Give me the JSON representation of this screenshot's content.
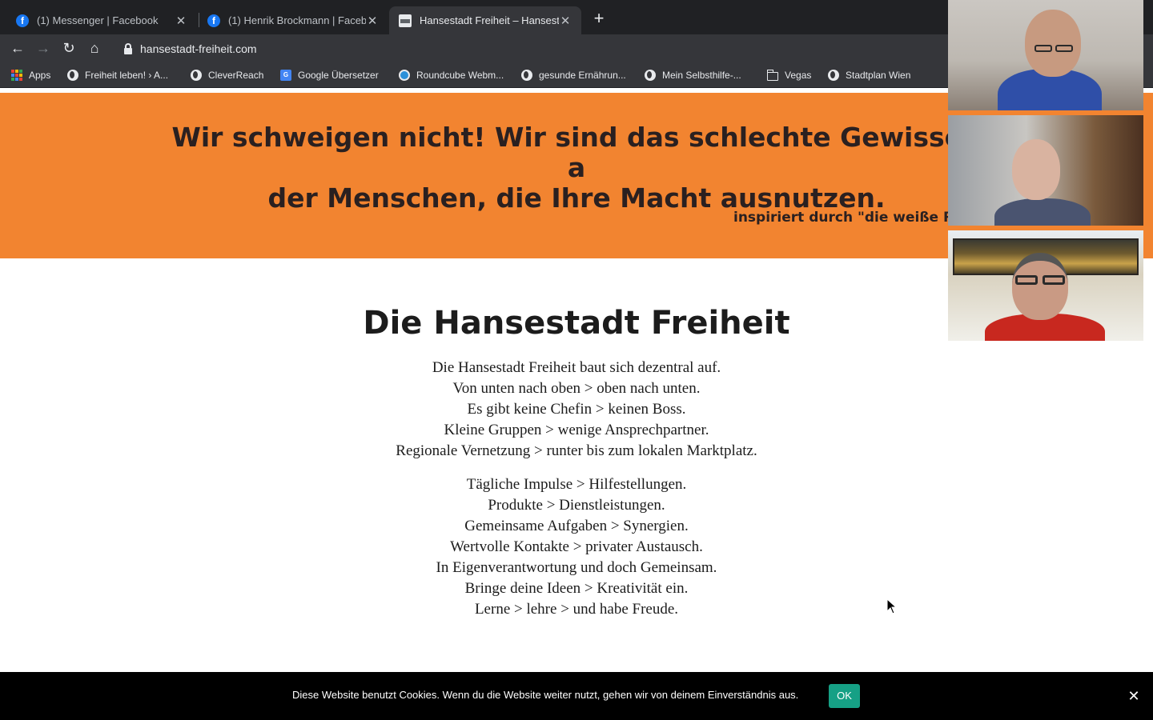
{
  "browser": {
    "tabs": [
      {
        "title": "(1) Messenger | Facebook",
        "icon": "facebook-icon",
        "close": "✕"
      },
      {
        "title": "(1) Henrik Brockmann | Facebook",
        "icon": "facebook-icon",
        "close": "✕"
      },
      {
        "title": "Hansestadt Freiheit – Hansestadt Freiheit",
        "icon": "page-icon",
        "close": "✕"
      }
    ],
    "new_tab": "+",
    "url": "hansestadt-freiheit.com",
    "bookmarks": [
      {
        "label": "Apps",
        "icon": "apps-grid-icon"
      },
      {
        "label": "Freiheit leben! › A...",
        "icon": "globe-icon"
      },
      {
        "label": "CleverReach",
        "icon": "globe-icon"
      },
      {
        "label": "Google Übersetzer",
        "icon": "google-translate-icon"
      },
      {
        "label": "Roundcube Webm...",
        "icon": "roundcube-icon"
      },
      {
        "label": "gesunde Ernährun...",
        "icon": "globe-icon"
      },
      {
        "label": "Mein Selbsthilfe-...",
        "icon": "globe-icon"
      },
      {
        "label": "Vegas",
        "icon": "folder-icon"
      },
      {
        "label": "Stadtplan Wien",
        "icon": "globe-icon"
      }
    ]
  },
  "hero": {
    "title_line1": "Wir schweigen nicht! Wir sind das schlechte Gewissen a",
    "title_line2": "der Menschen, die Ihre Macht ausnutzen.",
    "subtitle": "inspiriert durch \"die weiße Ro",
    "background": "#f28430"
  },
  "section": {
    "title": "Die Hansestadt Freiheit",
    "paragraph1": [
      "Die Hansestadt Freiheit baut sich dezentral auf.",
      "Von unten nach oben > oben nach unten.",
      "Es gibt keine Chefin > keinen Boss.",
      "Kleine Gruppen > wenige Ansprechpartner.",
      "Regionale Vernetzung > runter bis zum lokalen Marktplatz."
    ],
    "paragraph2": [
      "Tägliche Impulse > Hilfestellungen.",
      "Produkte > Dienstleistungen.",
      "Gemeinsame Aufgaben > Synergien.",
      "Wertvolle Kontakte > privater Austausch.",
      "In Eigenverantwortung und doch Gemeinsam.",
      "Bringe deine Ideen > Kreativität ein.",
      "Lerne > lehre > und habe Freude."
    ]
  },
  "cookie": {
    "text": "Diese Website benutzt Cookies. Wenn du die Website weiter nutzt, gehen wir von deinem Einverständnis aus.",
    "ok": "OK",
    "close": "✕",
    "ok_color": "#16a085"
  },
  "video_call": {
    "participants": 3
  }
}
